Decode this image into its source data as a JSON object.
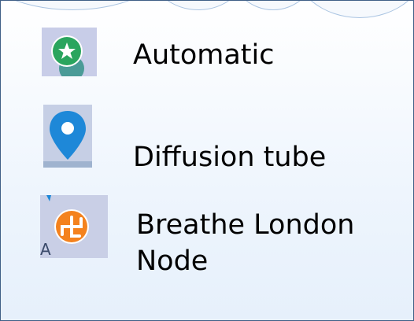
{
  "legend": {
    "items": [
      {
        "icon": "green-star-circle-icon",
        "color": "#2aa55e",
        "label": "Automatic"
      },
      {
        "icon": "blue-map-pin-icon",
        "color": "#1e88d8",
        "label": "Diffusion tube"
      },
      {
        "icon": "orange-swirl-circle-icon",
        "color": "#f4821e",
        "label_line1": "Breathe London",
        "label_line2": "Node"
      }
    ]
  }
}
